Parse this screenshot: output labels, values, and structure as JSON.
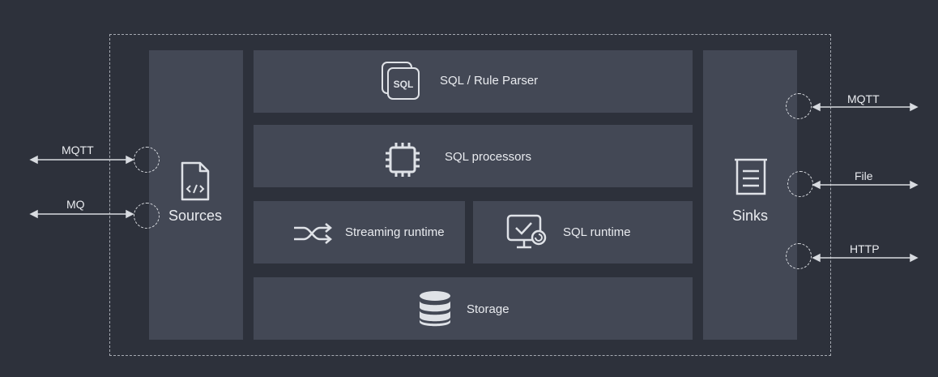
{
  "parser": {
    "label": "SQL / Rule Parser",
    "icon": "sql-file-stack-icon",
    "icon_text": "SQL"
  },
  "processors": {
    "label": "SQL processors",
    "icon": "cpu-chip-icon"
  },
  "streaming_runtime": {
    "label": "Streaming runtime",
    "icon": "shuffle-icon"
  },
  "sql_runtime": {
    "label": "SQL runtime",
    "icon": "monitor-check-icon"
  },
  "storage": {
    "label": "Storage",
    "icon": "database-icon"
  },
  "sources": {
    "label": "Sources",
    "icon": "code-file-icon",
    "inputs": [
      {
        "label": "MQTT"
      },
      {
        "label": "MQ"
      }
    ]
  },
  "sinks": {
    "label": "Sinks",
    "icon": "list-document-icon",
    "outputs": [
      {
        "label": "MQTT"
      },
      {
        "label": "File"
      },
      {
        "label": "HTTP"
      }
    ]
  },
  "colors": {
    "background": "#2d313b",
    "panel": "#434855",
    "line": "#d8dbe0"
  }
}
